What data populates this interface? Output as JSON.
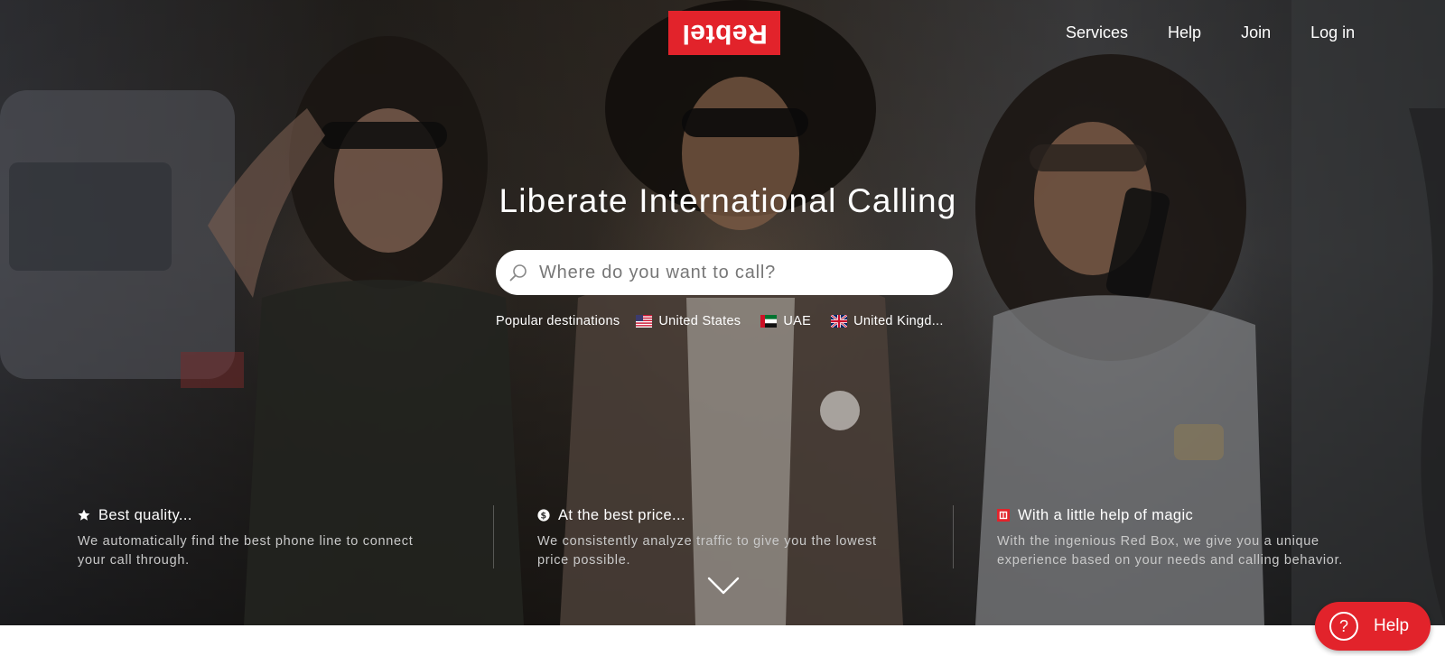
{
  "brand": {
    "logo_text": "Rebtel",
    "accent_color": "#e2232b"
  },
  "nav": {
    "items": [
      "Services",
      "Help",
      "Join",
      "Log in"
    ]
  },
  "hero": {
    "title": "Liberate International Calling",
    "search": {
      "placeholder": "Where do you want to call?",
      "value": "",
      "icon": "search-icon"
    },
    "popular": {
      "label": "Popular destinations",
      "destinations": [
        {
          "name": "United States",
          "flag": "us-flag-icon"
        },
        {
          "name": "UAE",
          "flag": "uae-flag-icon"
        },
        {
          "name": "United Kingd...",
          "flag": "uk-flag-icon"
        }
      ]
    }
  },
  "features": [
    {
      "icon": "star-icon",
      "title": "Best quality...",
      "description_line1": "We automatically find the best phone line to connect",
      "description_line2": "your call through."
    },
    {
      "icon": "dollar-icon",
      "title": "At the best price...",
      "description_line1": "We consistently analyze traffic to give you the lowest",
      "description_line2": "price possible."
    },
    {
      "icon": "red-box-icon",
      "title": "With a little help of magic",
      "description_line1": "With the ingenious Red Box, we give you a unique",
      "description_line2": "experience based on your needs and calling behavior."
    }
  ],
  "scroll": {
    "icon": "chevron-down-icon"
  },
  "help_widget": {
    "label": "Help",
    "glyph": "?",
    "icon": "help-circle-icon"
  }
}
